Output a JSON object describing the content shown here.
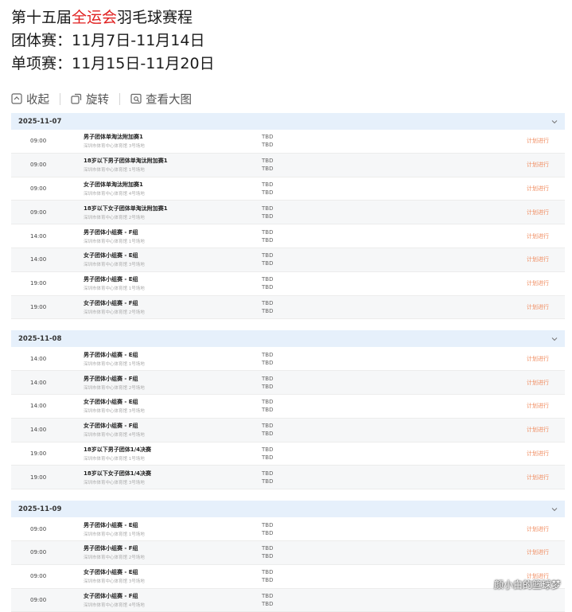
{
  "header": {
    "line1_before": "第十五届",
    "line1_highlight": "全运会",
    "line1_after": "羽毛球赛程",
    "line2": "团体赛：11月7日-11月14日",
    "line3": "单项赛：11月15日-11月20日"
  },
  "toolbar": {
    "collapse": "收起",
    "rotate": "旋转",
    "view_large": "查看大图"
  },
  "colors": {
    "highlight": "#e02020",
    "status": "#f08a5d",
    "date_bar": "#e6f0fb"
  },
  "schedule": [
    {
      "date": "2025-11-07",
      "rows": [
        {
          "time": "09:00",
          "event": "男子团体单淘汰附加赛1",
          "venue": "深圳市体育中心体育馆 3号场地",
          "team1": "TBD",
          "team2": "TBD",
          "status": "计划进行"
        },
        {
          "time": "09:00",
          "event": "18岁以下男子团体单淘汰附加赛1",
          "venue": "深圳市体育中心体育馆 1号场地",
          "team1": "TBD",
          "team2": "TBD",
          "status": "计划进行"
        },
        {
          "time": "09:00",
          "event": "女子团体单淘汰附加赛1",
          "venue": "深圳市体育中心体育馆 4号场地",
          "team1": "TBD",
          "team2": "TBD",
          "status": "计划进行"
        },
        {
          "time": "09:00",
          "event": "18岁以下女子团体单淘汰附加赛1",
          "venue": "深圳市体育中心体育馆 2号场地",
          "team1": "TBD",
          "team2": "TBD",
          "status": "计划进行"
        },
        {
          "time": "14:00",
          "event": "男子团体小组赛 - F组",
          "venue": "深圳市体育中心体育馆 1号场地",
          "team1": "TBD",
          "team2": "TBD",
          "status": "计划进行"
        },
        {
          "time": "14:00",
          "event": "女子团体小组赛 - E组",
          "venue": "深圳市体育中心体育馆 3号场地",
          "team1": "TBD",
          "team2": "TBD",
          "status": "计划进行"
        },
        {
          "time": "19:00",
          "event": "男子团体小组赛 - E组",
          "venue": "深圳市体育中心体育馆 1号场地",
          "team1": "TBD",
          "team2": "TBD",
          "status": "计划进行"
        },
        {
          "time": "19:00",
          "event": "女子团体小组赛 - F组",
          "venue": "深圳市体育中心体育馆 2号场地",
          "team1": "TBD",
          "team2": "TBD",
          "status": "计划进行"
        }
      ]
    },
    {
      "date": "2025-11-08",
      "rows": [
        {
          "time": "14:00",
          "event": "男子团体小组赛 - E组",
          "venue": "深圳市体育中心体育馆 1号场地",
          "team1": "TBD",
          "team2": "TBD",
          "status": "计划进行"
        },
        {
          "time": "14:00",
          "event": "男子团体小组赛 - F组",
          "venue": "深圳市体育中心体育馆 2号场地",
          "team1": "TBD",
          "team2": "TBD",
          "status": "计划进行"
        },
        {
          "time": "14:00",
          "event": "女子团体小组赛 - E组",
          "venue": "深圳市体育中心体育馆 3号场地",
          "team1": "TBD",
          "team2": "TBD",
          "status": "计划进行"
        },
        {
          "time": "14:00",
          "event": "女子团体小组赛 - F组",
          "venue": "深圳市体育中心体育馆 4号场地",
          "team1": "TBD",
          "team2": "TBD",
          "status": "计划进行"
        },
        {
          "time": "19:00",
          "event": "18岁以下男子团体1/4决赛",
          "venue": "深圳市体育中心体育馆 1号场地",
          "team1": "TBD",
          "team2": "TBD",
          "status": "计划进行"
        },
        {
          "time": "19:00",
          "event": "18岁以下女子团体1/4决赛",
          "venue": "深圳市体育中心体育馆 3号场地",
          "team1": "TBD",
          "team2": "TBD",
          "status": "计划进行"
        }
      ]
    },
    {
      "date": "2025-11-09",
      "rows": [
        {
          "time": "09:00",
          "event": "男子团体小组赛 - E组",
          "venue": "深圳市体育中心体育馆 1号场地",
          "team1": "TBD",
          "team2": "TBD",
          "status": "计划进行"
        },
        {
          "time": "09:00",
          "event": "男子团体小组赛 - F组",
          "venue": "深圳市体育中心体育馆 2号场地",
          "team1": "TBD",
          "team2": "TBD",
          "status": "计划进行"
        },
        {
          "time": "09:00",
          "event": "女子团体小组赛 - E组",
          "venue": "深圳市体育中心体育馆 3号场地",
          "team1": "TBD",
          "team2": "TBD",
          "status": "计划进行"
        },
        {
          "time": "09:00",
          "event": "女子团体小组赛 - F组",
          "venue": "深圳市体育中心体育馆 4号场地",
          "team1": "TBD",
          "team2": "TBD",
          "status": ""
        }
      ]
    }
  ],
  "watermark": "颜小白的篮球梦"
}
